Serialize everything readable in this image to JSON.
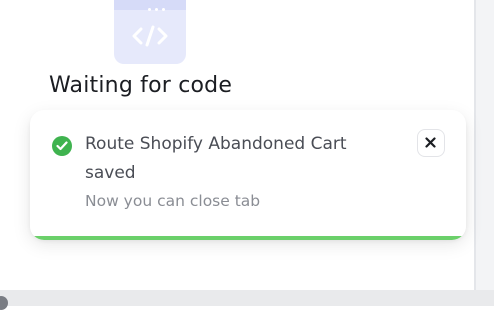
{
  "heading": "Waiting for code",
  "illustration": {
    "icon": "code-brackets-icon"
  },
  "toast": {
    "title": "Route Shopify Abandoned Cart saved",
    "subtitle": "Now you can close tab",
    "status_icon": "check-circle-icon",
    "close_icon": "close-icon",
    "progress_fraction": 1.0
  },
  "colors": {
    "success": "#3fb34f",
    "progress": "#6bd06a",
    "illustration_bg": "#e6e9fb",
    "heading": "#1b1d22"
  }
}
